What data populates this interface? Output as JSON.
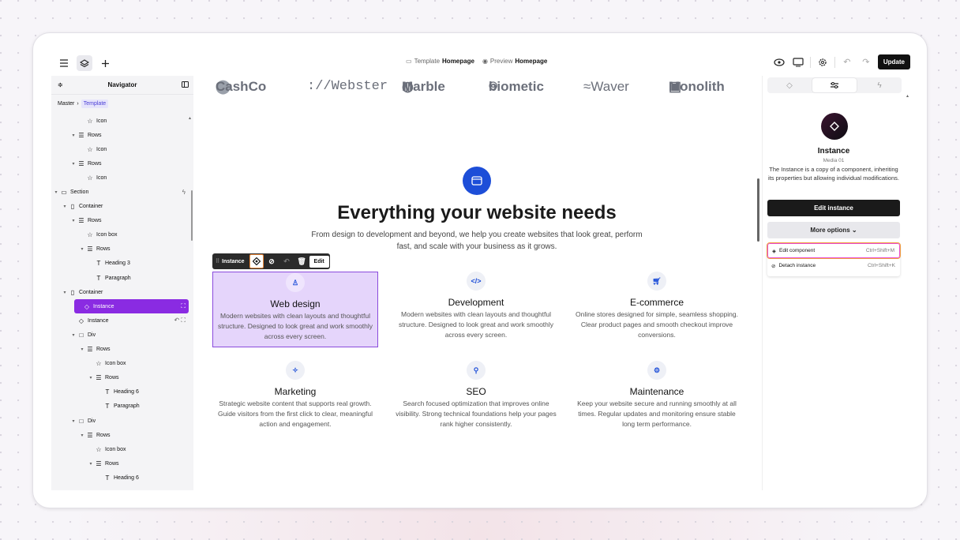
{
  "topbar": {
    "template_label": "Template",
    "template_name": "Homepage",
    "preview_label": "Preview",
    "preview_name": "Homepage",
    "update_label": "Update"
  },
  "navigator": {
    "title": "Navigator",
    "breadcrumb": [
      "Master",
      "Template"
    ],
    "rows": [
      {
        "label": "Icon",
        "indent": 3,
        "caret": "",
        "glyph": "☆"
      },
      {
        "label": "Rows",
        "indent": 2,
        "caret": "▾",
        "glyph": "☰"
      },
      {
        "label": "Icon",
        "indent": 3,
        "caret": "",
        "glyph": "☆"
      },
      {
        "label": "Rows",
        "indent": 2,
        "caret": "▾",
        "glyph": "☰"
      },
      {
        "label": "Icon",
        "indent": 3,
        "caret": "",
        "glyph": "☆"
      },
      {
        "label": "Section",
        "indent": 0,
        "caret": "▾",
        "glyph": "▭",
        "right": "ϟ"
      },
      {
        "label": "Container",
        "indent": 1,
        "caret": "▾",
        "glyph": "▯"
      },
      {
        "label": "Rows",
        "indent": 2,
        "caret": "▾",
        "glyph": "☰"
      },
      {
        "label": "Icon box",
        "indent": 3,
        "caret": "",
        "glyph": "☆"
      },
      {
        "label": "Rows",
        "indent": 3,
        "caret": "▾",
        "glyph": "☰"
      },
      {
        "label": "Heading 3",
        "indent": 4,
        "caret": "",
        "glyph": "T"
      },
      {
        "label": "Paragraph",
        "indent": 4,
        "caret": "",
        "glyph": "T"
      },
      {
        "label": "Container",
        "indent": 1,
        "caret": "▾",
        "glyph": "▯"
      },
      {
        "label": "Instance",
        "indent": 2,
        "caret": "",
        "glyph": "◇",
        "selected": true,
        "right": "⛶"
      },
      {
        "label": "Instance",
        "indent": 2,
        "caret": "",
        "glyph": "◇",
        "right": "↶ ⛶"
      },
      {
        "label": "Div",
        "indent": 2,
        "caret": "▾",
        "glyph": "□"
      },
      {
        "label": "Rows",
        "indent": 3,
        "caret": "▾",
        "glyph": "☰"
      },
      {
        "label": "Icon box",
        "indent": 4,
        "caret": "",
        "glyph": "☆"
      },
      {
        "label": "Rows",
        "indent": 4,
        "caret": "▾",
        "glyph": "☰"
      },
      {
        "label": "Heading 6",
        "indent": 5,
        "caret": "",
        "glyph": "T"
      },
      {
        "label": "Paragraph",
        "indent": 5,
        "caret": "",
        "glyph": "T"
      },
      {
        "label": "Div",
        "indent": 2,
        "caret": "▾",
        "glyph": "□"
      },
      {
        "label": "Rows",
        "indent": 3,
        "caret": "▾",
        "glyph": "☰"
      },
      {
        "label": "Icon box",
        "indent": 4,
        "caret": "",
        "glyph": "☆"
      },
      {
        "label": "Rows",
        "indent": 4,
        "caret": "▾",
        "glyph": "☰"
      },
      {
        "label": "Heading 6",
        "indent": 5,
        "caret": "",
        "glyph": "T"
      }
    ]
  },
  "canvas": {
    "logos": [
      "CashCo",
      "://Webster",
      "Marble",
      "biometic",
      "≈Waver",
      "Monolith"
    ],
    "heading": "Everything your website needs",
    "subheading": "From design to development and beyond, we help you create websites that look great, perform fast, and scale with your business as it grows.",
    "instance_toolbar": {
      "label": "Instance",
      "edit_label": "Edit"
    },
    "cards": [
      {
        "title": "Web design",
        "text": "Modern websites with clean layouts and thoughtful structure. Designed to look great and work smoothly across every screen.",
        "icon": "brush-icon",
        "glyph": "♙",
        "selected": true
      },
      {
        "title": "Development",
        "text": "Modern websites with clean layouts and thoughtful structure. Designed to look great and work smoothly across every screen.",
        "icon": "code-icon",
        "glyph": "</>"
      },
      {
        "title": "E-commerce",
        "text": "Online stores designed for simple, seamless shopping. Clear product pages and smooth checkout improve conversions.",
        "icon": "cart-icon",
        "glyph": "🛒︎"
      },
      {
        "title": "Marketing",
        "text": "Strategic website content that supports real growth. Guide visitors from the first click to clear, meaningful action and engagement.",
        "icon": "sparkle-icon",
        "glyph": "✧"
      },
      {
        "title": "SEO",
        "text": "Search focused optimization that improves online visibility. Strong technical foundations help your pages rank higher consistently.",
        "icon": "search-icon",
        "glyph": "⚲"
      },
      {
        "title": "Maintenance",
        "text": "Keep your website secure and running smoothly at all times. Regular updates and monitoring ensure stable long term performance.",
        "icon": "gear-icon",
        "glyph": "⚙"
      }
    ]
  },
  "panel": {
    "title": "Instance",
    "subtitle": "Media 01",
    "description": "The Instance is a copy of a component, inheriting its properties but allowing individual modifications.",
    "edit_instance_label": "Edit instance",
    "more_options_label": "More options ⌄",
    "menu": [
      {
        "label": "Edit component",
        "shortcut": "Ctrl+Shift+M",
        "icon": "component-icon"
      },
      {
        "label": "Detach instance",
        "shortcut": "Ctrl+Shift+K",
        "icon": "detach-icon"
      }
    ]
  },
  "colors": {
    "accent": "#8a2be2",
    "hero_icon": "#1d4ed8",
    "selection_fill": "#e5d5fb"
  }
}
